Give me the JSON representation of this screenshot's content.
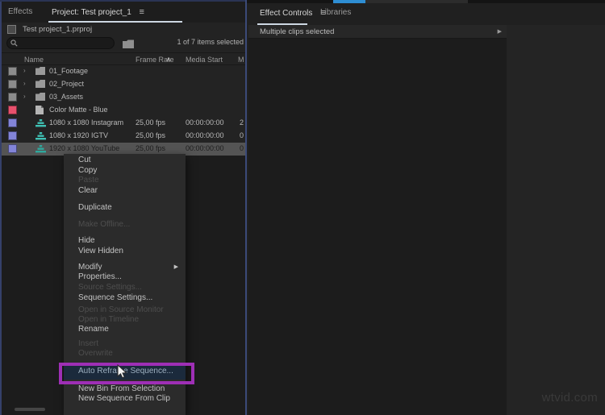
{
  "icons": {
    "panel_menu": "≡",
    "sort_ascending": "∧",
    "folder_chevron": "›",
    "submenu_arrow": "▶",
    "expand_arrow": "▶"
  },
  "colors": {
    "annotation_purple": "#9e2fb5",
    "menu_selection_highlight": "#1b2a3c",
    "label_purple": "#8284d8",
    "label_pink": "#e8516d",
    "label_gray": "#8c8c8c",
    "sequence_icon_teal": "#3fc1b4",
    "active_tab_underline": "#cdd7e2"
  },
  "project_panel": {
    "tabs": [
      {
        "label": "Effects"
      },
      {
        "label": "Project: Test project_1"
      }
    ],
    "project_file": "Test project_1.prproj",
    "selection_status": "1 of 7 items selected",
    "columns": {
      "name": "Name",
      "frame_rate": "Frame Rate",
      "media_start": "Media Start",
      "m": "M"
    },
    "rows": [
      {
        "name": "01_Footage",
        "type": "folder",
        "frame_rate": "",
        "media_start": "",
        "m": ""
      },
      {
        "name": "02_Project",
        "type": "folder",
        "frame_rate": "",
        "media_start": "",
        "m": ""
      },
      {
        "name": "03_Assets",
        "type": "folder",
        "frame_rate": "",
        "media_start": "",
        "m": ""
      },
      {
        "name": "Color Matte - Blue",
        "type": "matte",
        "frame_rate": "",
        "media_start": "",
        "m": ""
      },
      {
        "name": "1080 x 1080 Instagram",
        "type": "sequence",
        "frame_rate": "25,00 fps",
        "media_start": "00:00:00:00",
        "m": "2"
      },
      {
        "name": "1080 x 1920 IGTV",
        "type": "sequence",
        "frame_rate": "25,00 fps",
        "media_start": "00:00:00:00",
        "m": "0"
      },
      {
        "name": "1920 x 1080 YouTube",
        "type": "sequence",
        "frame_rate": "25,00 fps",
        "media_start": "00:00:00:00",
        "m": "0",
        "selected": true
      }
    ]
  },
  "context_menu": {
    "items": [
      {
        "label": "Cut"
      },
      {
        "label": "Copy"
      },
      {
        "label": "Paste",
        "disabled": true
      },
      {
        "label": "Clear"
      },
      {
        "label": "Duplicate"
      },
      {
        "label": "Make Offline...",
        "disabled": true
      },
      {
        "label": "Hide"
      },
      {
        "label": "View Hidden"
      },
      {
        "label": "Modify",
        "submenu": true
      },
      {
        "label": "Properties..."
      },
      {
        "label": "Source Settings...",
        "disabled": true
      },
      {
        "label": "Sequence Settings..."
      },
      {
        "label": "Open in Source Monitor",
        "disabled": true
      },
      {
        "label": "Open in Timeline",
        "disabled": true
      },
      {
        "label": "Rename"
      },
      {
        "label": "Insert",
        "disabled": true
      },
      {
        "label": "Overwrite",
        "disabled": true
      },
      {
        "label": "Auto Reframe Sequence...",
        "highlighted": true
      },
      {
        "label": "New Bin From Selection"
      },
      {
        "label": "New Sequence From Clip"
      }
    ]
  },
  "effect_controls_panel": {
    "tabs": [
      {
        "label": "Effect Controls"
      },
      {
        "label": "Libraries"
      }
    ],
    "status_bar": "Multiple clips selected"
  },
  "watermark": "wtvid.com"
}
